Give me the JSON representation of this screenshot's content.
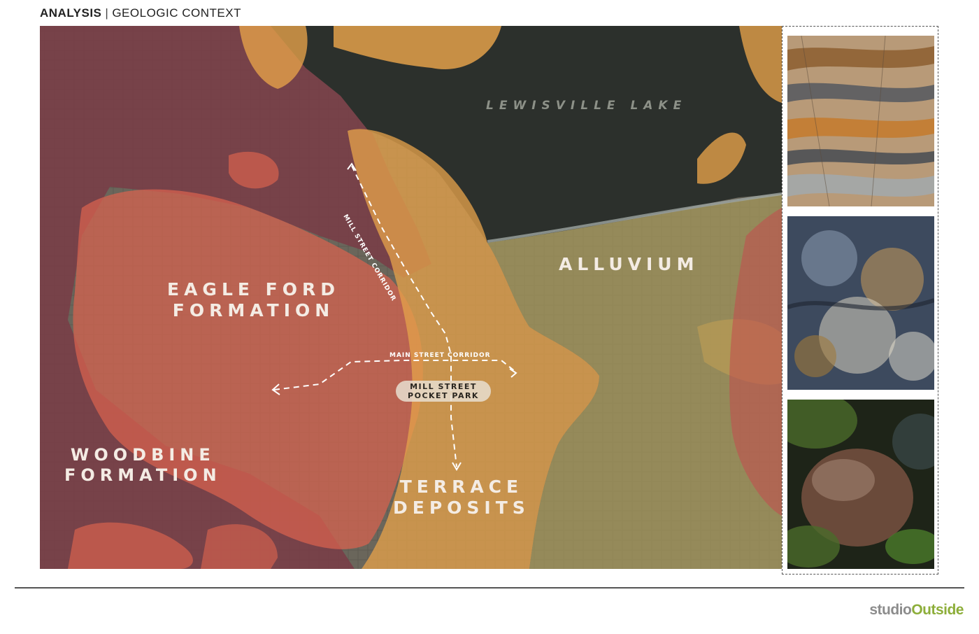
{
  "header": {
    "section": "ANALYSIS",
    "separator": "|",
    "subtitle": "GEOLOGIC CONTEXT"
  },
  "map": {
    "lake_label": "LEWISVILLE LAKE",
    "zones": [
      {
        "name_line1": "EAGLE FORD",
        "name_line2": "FORMATION",
        "color": "#d9624f"
      },
      {
        "name_line1": "WOODBINE",
        "name_line2": "FORMATION",
        "color": "#7a3b45"
      },
      {
        "name_line1": "ALLUVIUM",
        "name_line2": "",
        "color": "#a89a5a"
      },
      {
        "name_line1": "TERRACE",
        "name_line2": "DEPOSITS",
        "color": "#e3a04a"
      }
    ],
    "corridors": {
      "mill_street": "MILL STREET CORRIDOR",
      "main_street": "MAIN STREET CORRIDOR"
    },
    "park": {
      "line1": "MILL STREET",
      "line2": "POCKET PARK"
    },
    "colors": {
      "lake": "#2c302c",
      "route": "#ffffff"
    }
  },
  "photos": [
    {
      "icon": "layered-sandstone-photo"
    },
    {
      "icon": "weathered-rock-photo"
    },
    {
      "icon": "river-boulder-photo"
    }
  ],
  "brand": {
    "part1": "studio",
    "part2": "Outside",
    "color1": "#8c8c8c",
    "color2": "#8dae3a"
  }
}
